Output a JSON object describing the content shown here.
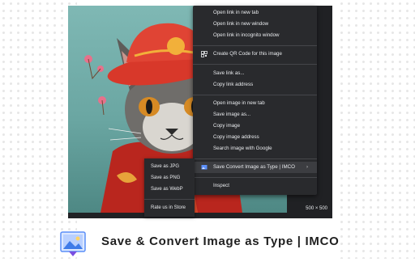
{
  "context_menu": {
    "items": [
      {
        "label": "Open link in new tab"
      },
      {
        "label": "Open link in new window"
      },
      {
        "label": "Open link in incognito window"
      },
      {
        "label": "Create QR Code for this image"
      },
      {
        "label": "Save link as..."
      },
      {
        "label": "Copy link address"
      },
      {
        "label": "Open image in new tab"
      },
      {
        "label": "Save image as..."
      },
      {
        "label": "Copy image"
      },
      {
        "label": "Copy image address"
      },
      {
        "label": "Search image with Google"
      },
      {
        "label": "Save  Convert Image as Type | IMCO"
      },
      {
        "label": "Inspect"
      }
    ]
  },
  "submenu": {
    "items": [
      {
        "label": "Save as JPG"
      },
      {
        "label": "Save as PNG"
      },
      {
        "label": "Save as WebP"
      },
      {
        "label": "Rate us in Store"
      }
    ]
  },
  "image_size": "500 × 500",
  "brand": {
    "title": "Save & Convert Image as Type | IMCO",
    "icon": "image-download-icon"
  },
  "colors": {
    "menu_bg": "#292a2d",
    "menu_text": "#e8eaed",
    "highlight": "#3c3d41",
    "icon_blue": "#5b8ff9"
  }
}
